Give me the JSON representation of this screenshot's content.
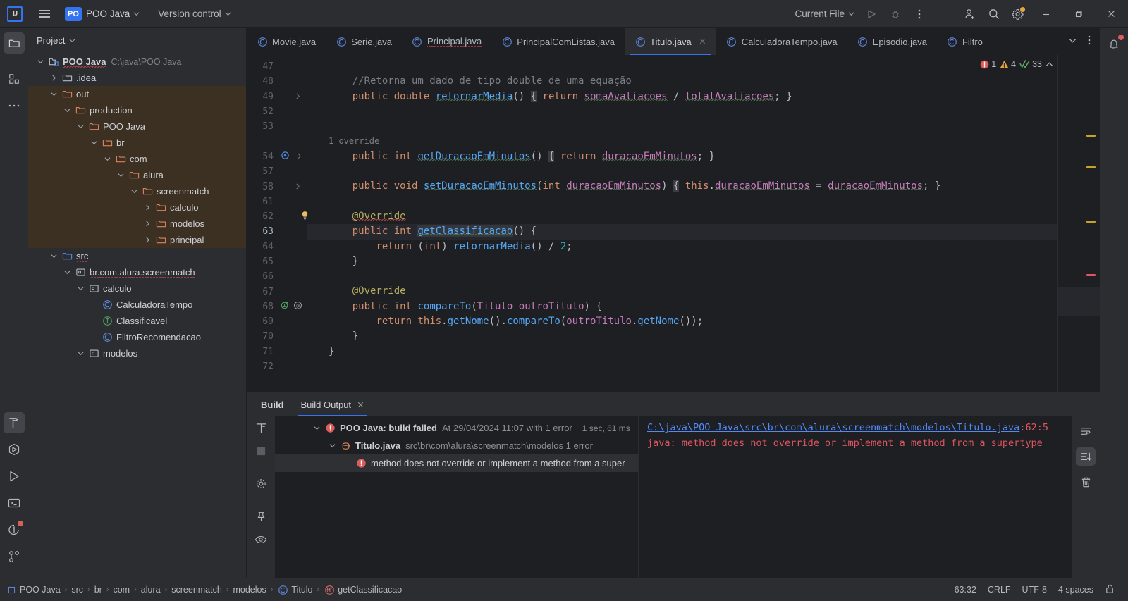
{
  "titlebar": {
    "logo": "IJ",
    "menu_icon": "hamburger-icon",
    "project_badge": "PO",
    "project_name": "POO Java",
    "version_control": "Version control",
    "run_config": "Current File",
    "icons": [
      "run-icon",
      "debug-icon",
      "more-actions-icon",
      "add-user-icon",
      "search-icon",
      "settings-icon"
    ],
    "window_minimize": "—",
    "window_maximize": "❐",
    "window_close": "✕"
  },
  "tool_strip": {
    "items": [
      {
        "name": "project-tool-icon",
        "label": "Project",
        "active": true
      },
      {
        "name": "structure-tool-icon",
        "label": "Structure",
        "active": false
      },
      {
        "name": "more-tool-windows-icon",
        "label": "More Tool Windows",
        "active": false
      }
    ],
    "bottom_items": [
      {
        "name": "build-tool-icon",
        "label": "Build",
        "active": true
      },
      {
        "name": "services-tool-icon",
        "label": "Services",
        "active": false
      },
      {
        "name": "run-tool-icon",
        "label": "Run",
        "active": false
      },
      {
        "name": "terminal-tool-icon",
        "label": "Terminal",
        "active": false
      },
      {
        "name": "problems-tool-icon",
        "label": "Problems",
        "active": false,
        "badge": true
      },
      {
        "name": "version-control-tool-icon",
        "label": "Version Control",
        "active": false
      }
    ]
  },
  "project_panel": {
    "header": "Project",
    "tree": [
      {
        "depth": 0,
        "arrow": "down",
        "icon": "project-icon",
        "label": "POO Java",
        "sub": "C:\\java\\POO Java",
        "bold": true,
        "squiggle": true,
        "selected": true
      },
      {
        "depth": 1,
        "arrow": "right",
        "icon": "folder-icon",
        "label": ".idea"
      },
      {
        "depth": 1,
        "arrow": "down",
        "icon": "folder-excluded-icon",
        "label": "out",
        "excluded": true
      },
      {
        "depth": 2,
        "arrow": "down",
        "icon": "folder-excluded-icon",
        "label": "production",
        "excluded": true
      },
      {
        "depth": 3,
        "arrow": "down",
        "icon": "folder-excluded-icon",
        "label": "POO Java",
        "excluded": true
      },
      {
        "depth": 4,
        "arrow": "down",
        "icon": "folder-excluded-icon",
        "label": "br",
        "excluded": true
      },
      {
        "depth": 5,
        "arrow": "down",
        "icon": "folder-excluded-icon",
        "label": "com",
        "excluded": true
      },
      {
        "depth": 6,
        "arrow": "down",
        "icon": "folder-excluded-icon",
        "label": "alura",
        "excluded": true
      },
      {
        "depth": 7,
        "arrow": "down",
        "icon": "folder-excluded-icon",
        "label": "screenmatch",
        "excluded": true
      },
      {
        "depth": 8,
        "arrow": "right",
        "icon": "folder-excluded-icon",
        "label": "calculo",
        "excluded": true
      },
      {
        "depth": 8,
        "arrow": "right",
        "icon": "folder-excluded-icon",
        "label": "modelos",
        "excluded": true
      },
      {
        "depth": 8,
        "arrow": "right",
        "icon": "folder-excluded-icon",
        "label": "principal",
        "excluded": true
      },
      {
        "depth": 1,
        "arrow": "down",
        "icon": "source-root-icon",
        "label": "src",
        "squiggle": true
      },
      {
        "depth": 2,
        "arrow": "down",
        "icon": "package-icon",
        "label": "br.com.alura.screenmatch",
        "squiggle": true
      },
      {
        "depth": 3,
        "arrow": "down",
        "icon": "package-icon",
        "label": "calculo"
      },
      {
        "depth": 4,
        "arrow": "none",
        "icon": "java-class-icon",
        "label": "CalculadoraTempo"
      },
      {
        "depth": 4,
        "arrow": "none",
        "icon": "java-interface-icon",
        "label": "Classificavel"
      },
      {
        "depth": 4,
        "arrow": "none",
        "icon": "java-class-icon",
        "label": "FiltroRecomendacao"
      },
      {
        "depth": 3,
        "arrow": "down",
        "icon": "package-icon",
        "label": "modelos"
      }
    ]
  },
  "editor": {
    "tabs": [
      {
        "label": "Movie.java",
        "icon": "java-class-icon",
        "active": false,
        "squiggle": false
      },
      {
        "label": "Serie.java",
        "icon": "java-class-icon",
        "active": false,
        "squiggle": false
      },
      {
        "label": "Principal.java",
        "icon": "java-class-icon",
        "active": false,
        "squiggle": true
      },
      {
        "label": "PrincipalComListas.java",
        "icon": "java-class-icon",
        "active": false,
        "squiggle": false
      },
      {
        "label": "Titulo.java",
        "icon": "java-class-icon",
        "active": true,
        "squiggle": false,
        "closable": true
      },
      {
        "label": "CalculadoraTempo.java",
        "icon": "java-class-icon",
        "active": false,
        "squiggle": false
      },
      {
        "label": "Episodio.java",
        "icon": "java-class-icon",
        "active": false,
        "squiggle": false
      },
      {
        "label": "Filtro",
        "icon": "java-class-icon",
        "active": false,
        "squiggle": false,
        "truncated": true
      }
    ],
    "tabbar_icons": [
      "chevron-down-icon",
      "more-tabs-icon"
    ],
    "inspection": {
      "errors": "1",
      "warnings": "4",
      "checks": "33",
      "collapse": "chevron-up-icon"
    },
    "inlay_hint": "1 override",
    "line_numbers": [
      "47",
      "48",
      "49",
      "52",
      "53",
      "",
      "54",
      "57",
      "58",
      "61",
      "62",
      "63",
      "64",
      "65",
      "66",
      "67",
      "68",
      "69",
      "70",
      "71",
      "72"
    ]
  },
  "code_lines": [
    {
      "num": "47",
      "text": ""
    },
    {
      "num": "48",
      "text": "    //Retorna um dado de tipo double de uma equação"
    },
    {
      "num": "49",
      "text": "    public double retornarMedia() { return somaAvaliacoes / totalAvaliacoes; }",
      "fold": true
    },
    {
      "num": "52",
      "text": ""
    },
    {
      "num": "53",
      "text": ""
    },
    {
      "num": "",
      "text": "    1 override",
      "inlay": true
    },
    {
      "num": "54",
      "text": "    public int getDuracaoEmMinutos() { return duracaoEmMinutos; }",
      "fold": true,
      "gutter": "overridden-method-icon"
    },
    {
      "num": "57",
      "text": ""
    },
    {
      "num": "58",
      "text": "    public void setDuracaoEmMinutos(int duracaoEmMinutos) { this.duracaoEmMinutos = duracaoEmMinutos; }",
      "fold": true
    },
    {
      "num": "61",
      "text": ""
    },
    {
      "num": "62",
      "text": "    @Override",
      "gutter": "intention-bulb-icon"
    },
    {
      "num": "63",
      "text": "    public int getClassificacao() {",
      "current": true
    },
    {
      "num": "64",
      "text": "        return (int) retornarMedia() / 2;"
    },
    {
      "num": "65",
      "text": "    }"
    },
    {
      "num": "66",
      "text": ""
    },
    {
      "num": "67",
      "text": "    @Override"
    },
    {
      "num": "68",
      "text": "    public int compareTo(Titulo outroTitulo) {",
      "gutter": "implementing-method-icon"
    },
    {
      "num": "69",
      "text": "        return this.getNome().compareTo(outroTitulo.getNome());"
    },
    {
      "num": "70",
      "text": "    }"
    },
    {
      "num": "71",
      "text": "}"
    },
    {
      "num": "72",
      "text": ""
    }
  ],
  "build_panel": {
    "tabs": [
      {
        "label": "Build",
        "selected": false,
        "bold": true
      },
      {
        "label": "Build Output",
        "selected": true,
        "closable": true
      }
    ],
    "actions": [
      "filter-icon",
      "stop-icon",
      "settings-icon",
      "pin-icon",
      "eye-icon"
    ],
    "tree": [
      {
        "depth": 0,
        "arrow": "down",
        "icon": "error-icon",
        "title": "POO Java: build failed",
        "detail": "At 29/04/2024 11:07 with 1 error",
        "time": "1 sec, 61 ms"
      },
      {
        "depth": 1,
        "arrow": "down",
        "icon": "java-file-icon",
        "title": "Titulo.java",
        "detail": "src\\br\\com\\alura\\screenmatch\\modelos 1 error"
      },
      {
        "depth": 2,
        "arrow": "none",
        "icon": "error-icon",
        "title": "method does not override or implement a method from a super",
        "selected": true
      }
    ],
    "console": {
      "link": "C:\\java\\POO Java\\src\\br\\com\\alura\\screenmatch\\modelos\\Titulo.java",
      "location": ":62:5",
      "message": "java: method does not override or implement a method from a supertype"
    },
    "right_actions": [
      "soft-wrap-icon",
      "scroll-to-end-icon",
      "clear-all-icon"
    ]
  },
  "statusbar": {
    "breadcrumbs": [
      {
        "label": "POO Java",
        "icon": "module-icon"
      },
      {
        "label": "src"
      },
      {
        "label": "br"
      },
      {
        "label": "com"
      },
      {
        "label": "alura"
      },
      {
        "label": "screenmatch"
      },
      {
        "label": "modelos"
      },
      {
        "label": "Titulo",
        "icon": "java-class-icon"
      },
      {
        "label": "getClassificacao",
        "icon": "method-icon"
      }
    ],
    "caret": "63:32",
    "line_separator": "CRLF",
    "encoding": "UTF-8",
    "indent": "4 spaces",
    "lock": "unlocked-icon"
  },
  "colors": {
    "accent": "#3574f0",
    "error": "#db5c5c",
    "warning": "#e8a33d",
    "success": "#5fad65",
    "excluded_bg": "#3c3022",
    "panel_bg": "#2b2d30",
    "editor_bg": "#1e1f22"
  }
}
